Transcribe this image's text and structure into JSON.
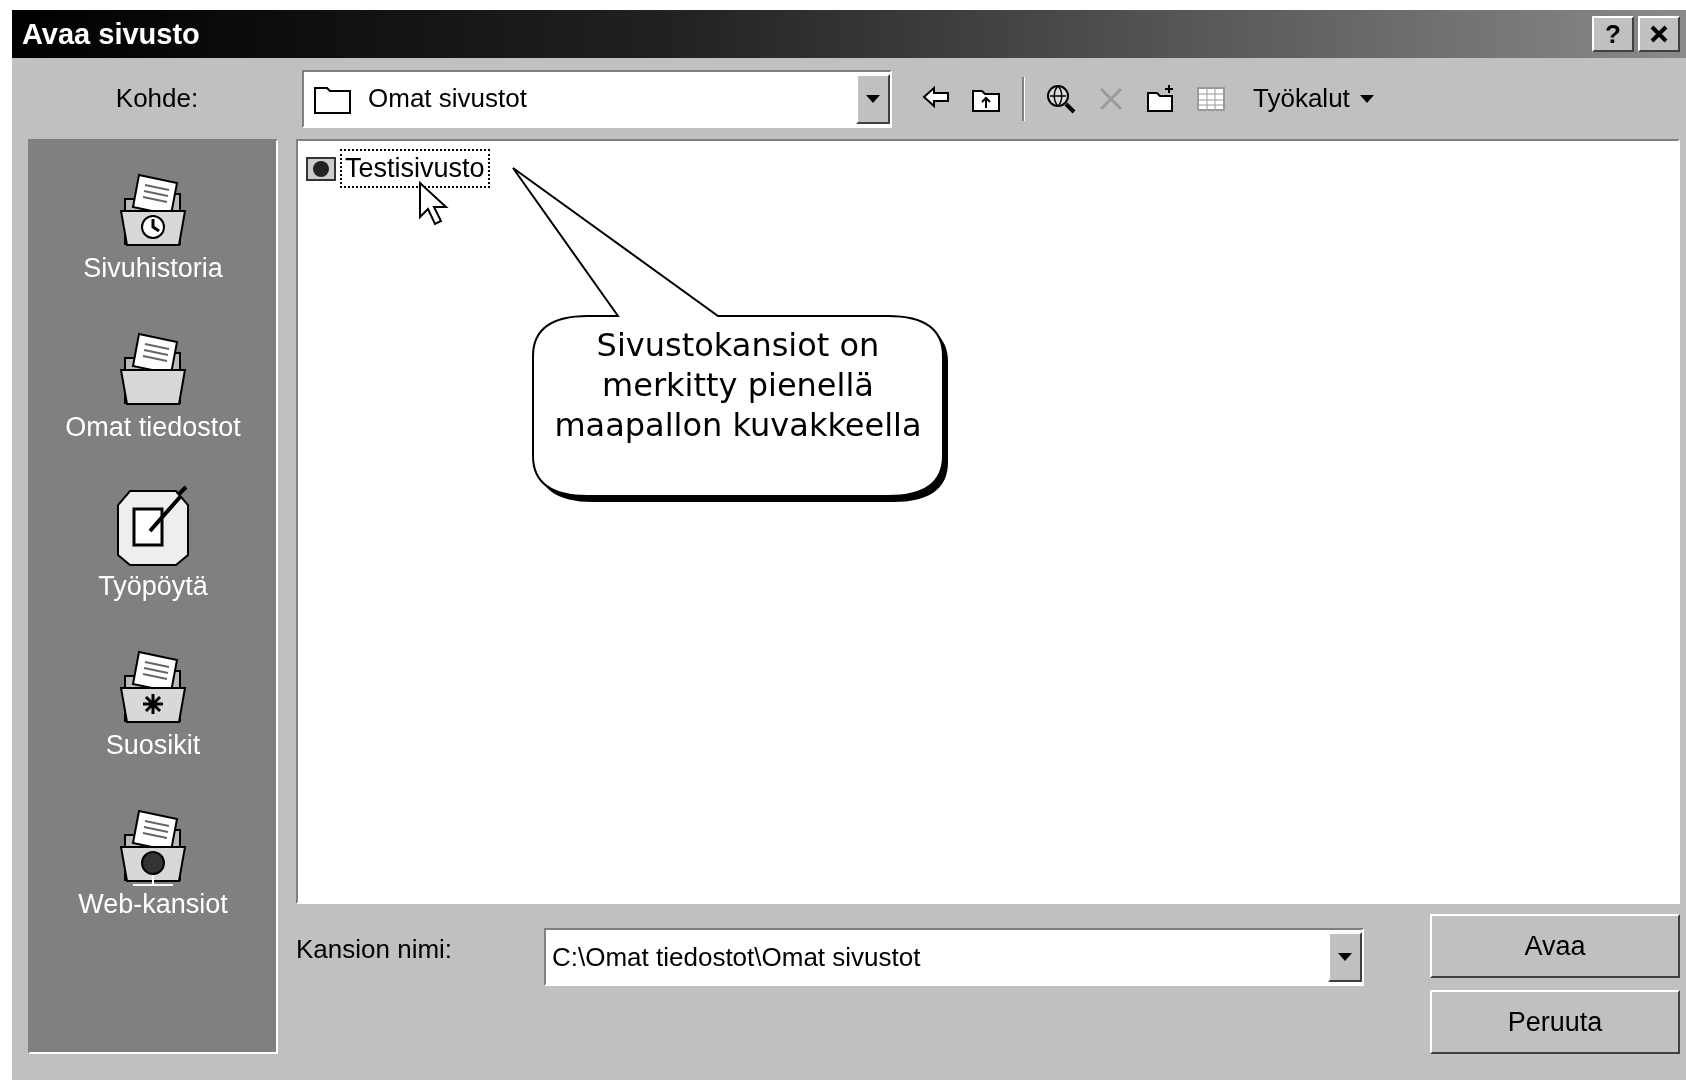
{
  "window": {
    "title": "Avaa sivusto",
    "help_button": "?"
  },
  "toolbar": {
    "label": "Kohde:",
    "location": "Omat sivustot",
    "tools_menu": "Työkalut",
    "buttons": [
      {
        "kind": "back",
        "disabled": false
      },
      {
        "kind": "up",
        "disabled": false
      },
      {
        "kind": "search",
        "disabled": false
      },
      {
        "kind": "delete",
        "disabled": true
      },
      {
        "kind": "new-folder",
        "disabled": false
      },
      {
        "kind": "views",
        "disabled": true
      }
    ]
  },
  "sidebar": {
    "items": [
      {
        "label": "Sivuhistoria",
        "kind": "history"
      },
      {
        "label": "Omat tiedostot",
        "kind": "documents"
      },
      {
        "label": "Työpöytä",
        "kind": "desktop"
      },
      {
        "label": "Suosikit",
        "kind": "favorites"
      },
      {
        "label": "Web-kansiot",
        "kind": "web"
      }
    ]
  },
  "files": [
    {
      "name": "Testisivusto",
      "selected": true
    }
  ],
  "callout": {
    "text": "Sivustokansiot on merkitty pienellä maapallon kuvakkeella"
  },
  "folder_name": {
    "label": "Kansion nimi:",
    "value": "C:\\Omat tiedostot\\Omat sivustot"
  },
  "buttons": [
    "Avaa",
    "Peruuta"
  ]
}
